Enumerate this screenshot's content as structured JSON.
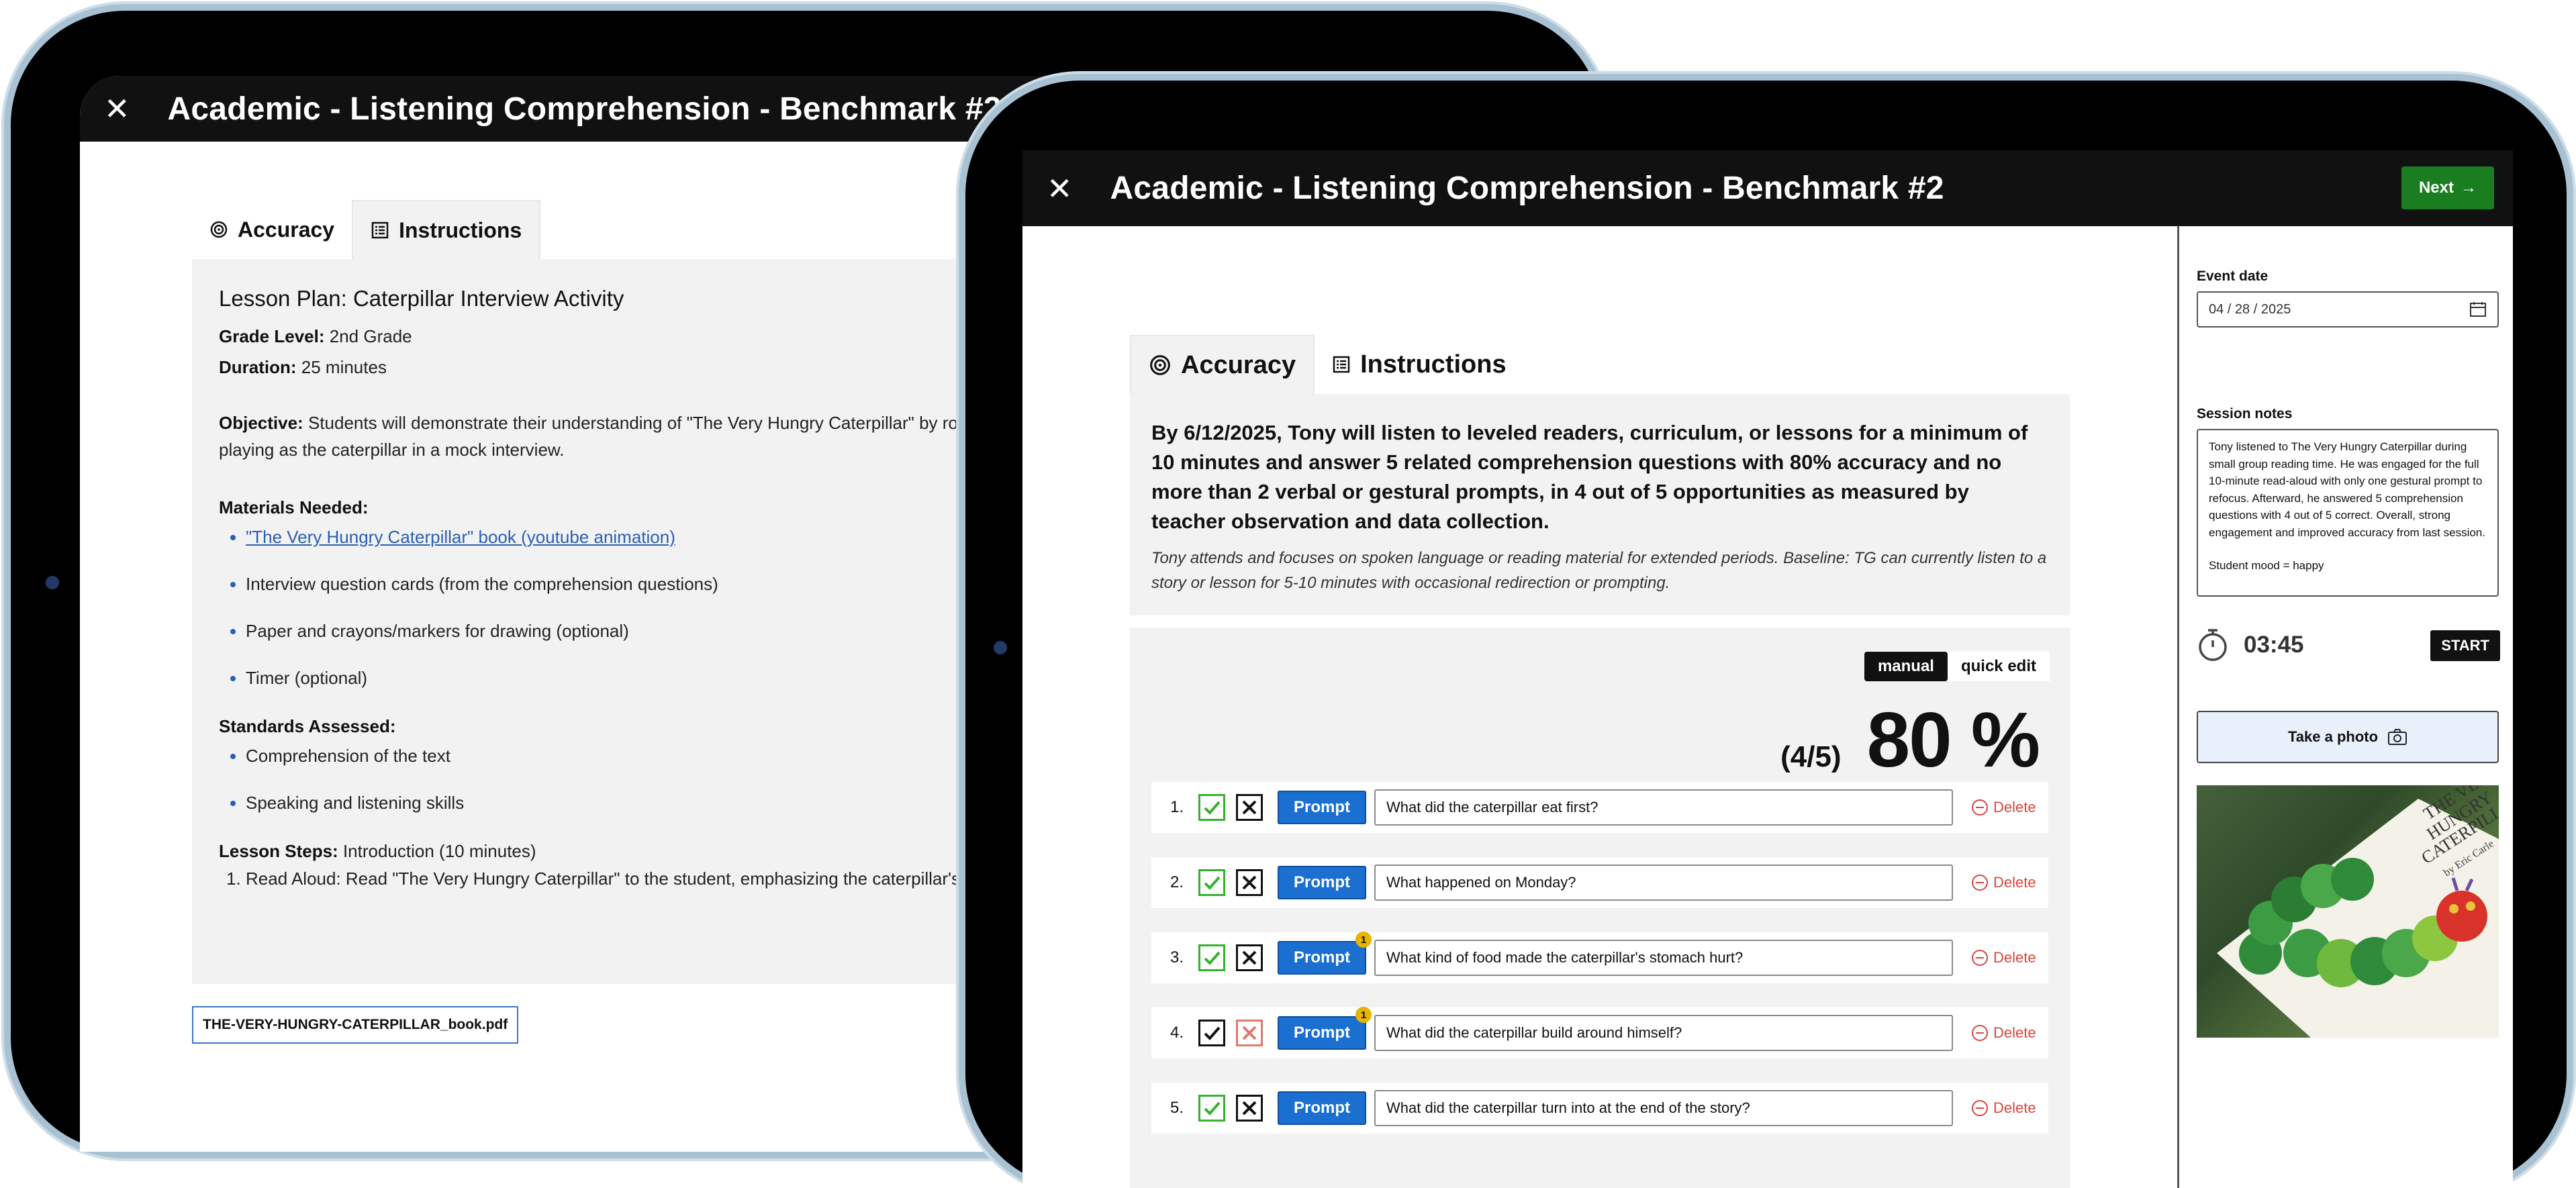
{
  "app": {
    "title": "Academic - Listening Comprehension - Benchmark #2",
    "close_icon": "close-icon",
    "next_label": "Next",
    "tabs": [
      {
        "label": "Accuracy",
        "icon": "target-icon"
      },
      {
        "label": "Instructions",
        "icon": "list-icon"
      }
    ]
  },
  "back": {
    "lesson_title": "Lesson Plan: Caterpillar Interview Activity",
    "grade_label": "Grade Level:",
    "grade_value": "2nd Grade",
    "duration_label": "Duration:",
    "duration_value": " 25 minutes",
    "objective_label": "Objective:",
    "objective_text": "Students will demonstrate their understanding of \"The Very Hungry Caterpillar\" by role-playing as the caterpillar in a mock interview.",
    "materials_label": "Materials Needed:",
    "materials": [
      "\"The Very Hungry Caterpillar\" book (youtube animation)",
      "Interview question cards (from the comprehension questions)",
      "Paper and crayons/markers for drawing (optional)",
      "Timer (optional)"
    ],
    "standards_label": "Standards Assessed:",
    "standards": [
      "Comprehension of the text",
      "Speaking and listening skills"
    ],
    "steps_label": "Lesson Steps:",
    "steps_value": " Introduction (10 minutes)",
    "steps": [
      "Read Aloud: Read \"The Very Hungry Caterpillar\" to the student, emphasizing the caterpillar's journey."
    ],
    "file_name": "THE-VERY-HUNGRY-CATERPILLAR_book.pdf"
  },
  "goal": {
    "text": "By 6/12/2025, Tony will listen to leveled readers, curriculum, or lessons for a minimum of 10 minutes and answer 5 related comprehension questions with 80% accuracy and no more than 2 verbal or gestural prompts, in 4 out of 5 opportunities as measured by teacher observation and data collection.",
    "baseline": "Tony attends and focuses on spoken language or reading material for extended periods. Baseline: TG can currently listen to a story or lesson for 5-10 minutes with occasional redirection or prompting."
  },
  "accuracy": {
    "mode_manual": "manual",
    "mode_quick": "quick edit",
    "fraction": "(4/5)",
    "percent": "80 %",
    "prompt_label": "Prompt",
    "delete_label": "Delete",
    "questions": [
      {
        "num": "1.",
        "text": "What did the caterpillar eat first?",
        "result": "correct",
        "prompts": ""
      },
      {
        "num": "2.",
        "text": "What happened on Monday?",
        "result": "correct",
        "prompts": ""
      },
      {
        "num": "3.",
        "text": "What kind of food made the caterpillar's stomach hurt?",
        "result": "correct",
        "prompts": "1"
      },
      {
        "num": "4.",
        "text": "What did the caterpillar build around himself?",
        "result": "incorrect",
        "prompts": "1"
      },
      {
        "num": "5.",
        "text": "What did the caterpillar turn into at the end of the story?",
        "result": "correct",
        "prompts": ""
      }
    ]
  },
  "sidebar": {
    "event_date_label": "Event date",
    "event_date": "04 / 28 / 2025",
    "calendar_icon": "calendar-icon",
    "session_notes_label": "Session notes",
    "session_notes": "Tony listened to The Very Hungry Caterpillar during small group reading time. He was engaged for the full 10-minute read-aloud with only one gestural prompt to refocus. Afterward, he answered 5 comprehension questions with 4 out of 5 correct. Overall, strong engagement and improved accuracy from last session.",
    "mood": "Student mood = happy",
    "timer": "03:45",
    "start_label": "START",
    "photo_label": "Take a photo",
    "photo_title_1": "THE VERY",
    "photo_title_2": "HUNGRY",
    "photo_title_3": "CATERPILLAR",
    "photo_author": "by Eric Carle"
  },
  "colors": {
    "header": "#111111",
    "next": "#1a7d1f",
    "prompt": "#1b6fd1",
    "correct": "#36b12e",
    "incorrect": "#e2776a",
    "delete": "#d9463b",
    "badge": "#e8b400",
    "link": "#2a5fb4"
  }
}
